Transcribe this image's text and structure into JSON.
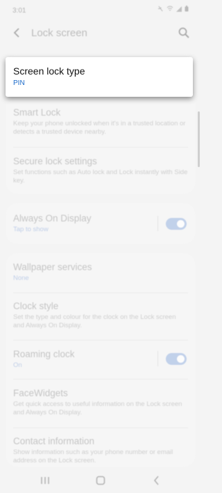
{
  "status_bar": {
    "time": "3:01",
    "icons": [
      "mute-icon",
      "wifi-icon",
      "signal-icon",
      "battery-icon"
    ]
  },
  "app_bar": {
    "title": "Lock screen",
    "back_icon": "back-arrow-icon",
    "search_icon": "search-icon"
  },
  "highlighted_item": {
    "title": "Screen lock type",
    "value": "PIN"
  },
  "group1": [
    {
      "title": "Smart Lock",
      "summary": "Keep your phone unlocked when it's in a trusted location or detects a trusted device nearby."
    },
    {
      "title": "Secure lock settings",
      "summary": "Set functions such as Auto lock and Lock instantly with Side key."
    }
  ],
  "aod": {
    "title": "Always On Display",
    "summary": "Tap to show",
    "toggle_on": true
  },
  "group3": [
    {
      "title": "Wallpaper services",
      "summary": "None"
    },
    {
      "title": "Clock style",
      "summary": "Set the type and colour for the clock on the Lock screen and Always On Display."
    },
    {
      "title": "Roaming clock",
      "summary": "On",
      "toggle_on": true
    },
    {
      "title": "FaceWidgets",
      "summary": "Get quick access to useful information on the Lock screen and Always On Display."
    },
    {
      "title": "Contact information",
      "summary": "Show information such as your phone number or email address on the Lock screen."
    }
  ],
  "colors": {
    "accent": "#1a6ac9",
    "background": "#f4f4f4"
  }
}
